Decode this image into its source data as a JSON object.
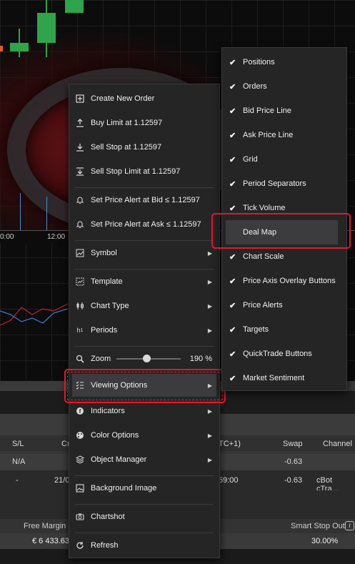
{
  "chart": {
    "time_labels": [
      "0:00",
      "12:00"
    ]
  },
  "context_menu": {
    "create_new_order": "Create New Order",
    "buy_limit": "Buy Limit at 1.12597",
    "sell_stop": "Sell Stop at 1.12597",
    "sell_stop_limit": "Sell Stop Limit at 1.12597",
    "alert_bid": "Set Price Alert at Bid ≤ 1.12597",
    "alert_ask": "Set Price Alert at Ask ≤ 1.12597",
    "symbol": "Symbol",
    "template": "Template",
    "chart_type": "Chart Type",
    "periods": "Periods",
    "zoom_label": "Zoom",
    "zoom_value": "190 %",
    "zoom_level": 0.47,
    "viewing_options": "Viewing Options",
    "indicators": "Indicators",
    "color_options": "Color Options",
    "object_manager": "Object Manager",
    "background_image": "Background Image",
    "chartshot": "Chartshot",
    "refresh": "Refresh"
  },
  "viewing_submenu": {
    "items": [
      {
        "label": "Positions",
        "checked": true
      },
      {
        "label": "Orders",
        "checked": true
      },
      {
        "label": "Bid Price Line",
        "checked": true
      },
      {
        "label": "Ask Price Line",
        "checked": true
      },
      {
        "label": "Grid",
        "checked": true
      },
      {
        "label": "Period Separators",
        "checked": true
      },
      {
        "label": "Tick Volume",
        "checked": true
      },
      {
        "label": "Deal Map",
        "checked": false
      },
      {
        "label": "Chart Scale",
        "checked": true
      },
      {
        "label": "Price Axis Overlay Buttons",
        "checked": true
      },
      {
        "label": "Price Alerts",
        "checked": true
      },
      {
        "label": "Targets",
        "checked": true
      },
      {
        "label": "QuickTrade Buttons",
        "checked": true
      },
      {
        "label": "Market Sentiment",
        "checked": true
      }
    ]
  },
  "positions_table": {
    "headers": {
      "sl": "S/L",
      "cr": "Cr",
      "time": "TC+1)",
      "swap": "Swap",
      "channel": "Channel"
    },
    "row1": {
      "sl": "N/A",
      "swap": "-0.63"
    },
    "row2": {
      "sl": "-",
      "date": "21/0",
      "time": "59:00",
      "swap": "-0.63",
      "channel": "cBot cTra..."
    }
  },
  "account_bar": {
    "free_margin_label": "Free Margin",
    "free_margin_value": "€ 6 433.63",
    "smart_stop_label": "Smart Stop Out",
    "smart_stop_value": "30.00%",
    "info_icon_glyph": "i"
  },
  "colors": {
    "highlight_border": "#e3172b",
    "candle_up": "#2fa44a",
    "tick_line": "#3d8fd6"
  }
}
